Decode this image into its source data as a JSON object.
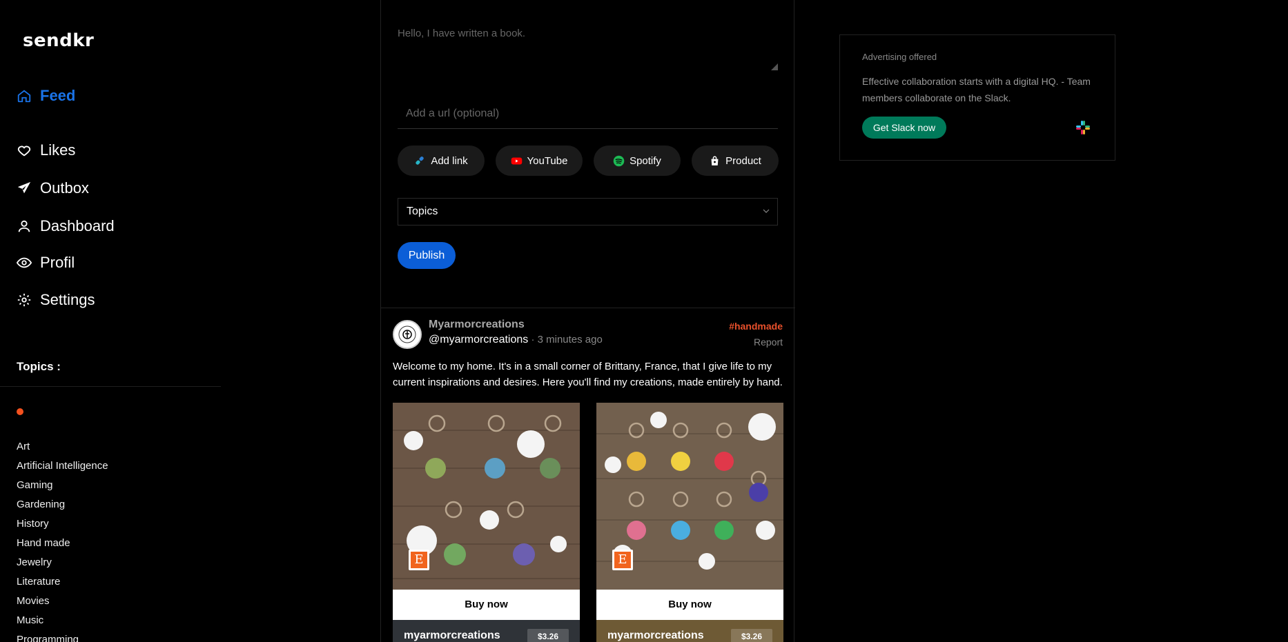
{
  "app": {
    "logo": "sendkr"
  },
  "nav": [
    {
      "label": "Feed",
      "icon": "home-icon",
      "active": true
    },
    {
      "label": "Likes",
      "icon": "heart-icon"
    },
    {
      "label": "Outbox",
      "icon": "paper-plane-icon"
    },
    {
      "label": "Dashboard",
      "icon": "user-icon"
    },
    {
      "label": "Profil",
      "icon": "eye-icon"
    },
    {
      "label": "Settings",
      "icon": "gear-icon"
    }
  ],
  "topics": {
    "heading": "Topics :",
    "items": [
      "Art",
      "Artificial Intelligence",
      "Gaming",
      "Gardening",
      "History",
      "Hand made",
      "Jewelry",
      "Literature",
      "Movies",
      "Music",
      "Programming"
    ]
  },
  "composer": {
    "text_placeholder": "Hello, I have written a book.",
    "url_placeholder": "Add a url (optional)",
    "chips": {
      "add_link": "Add link",
      "youtube": "YouTube",
      "spotify": "Spotify",
      "product": "Product"
    },
    "topics_select": "Topics",
    "publish": "Publish"
  },
  "post": {
    "author_name": "Myarmorcreations",
    "author_handle": "@myarmorcreations",
    "time": " · 3 minutes ago",
    "tag": "#handmade",
    "report": "Report",
    "body": "Welcome to my home. It's in a small corner of Brittany, France, that I give life to my current inspirations and desires. Here you'll find my creations, made entirely by hand.",
    "products": [
      {
        "buy_label": "Buy now",
        "shop": "myarmorcreations",
        "price": "$3.26",
        "badge": "E",
        "meta_color": "#2f3338"
      },
      {
        "buy_label": "Buy now",
        "shop": "myarmorcreations",
        "price": "$3.26",
        "badge": "E",
        "meta_color": "#6e5a35"
      }
    ]
  },
  "ad": {
    "label": "Advertising offered",
    "text": "Effective collaboration starts with a digital HQ. - Team members collaborate on the Slack.",
    "cta": "Get Slack now",
    "logo_icon": "slack-logo-icon"
  },
  "colors": {
    "accent": "#1a73e8",
    "publish": "#0b5ed7",
    "tag": "#e8502b",
    "etsy": "#f1641e",
    "slack_green": "#007a5a"
  }
}
